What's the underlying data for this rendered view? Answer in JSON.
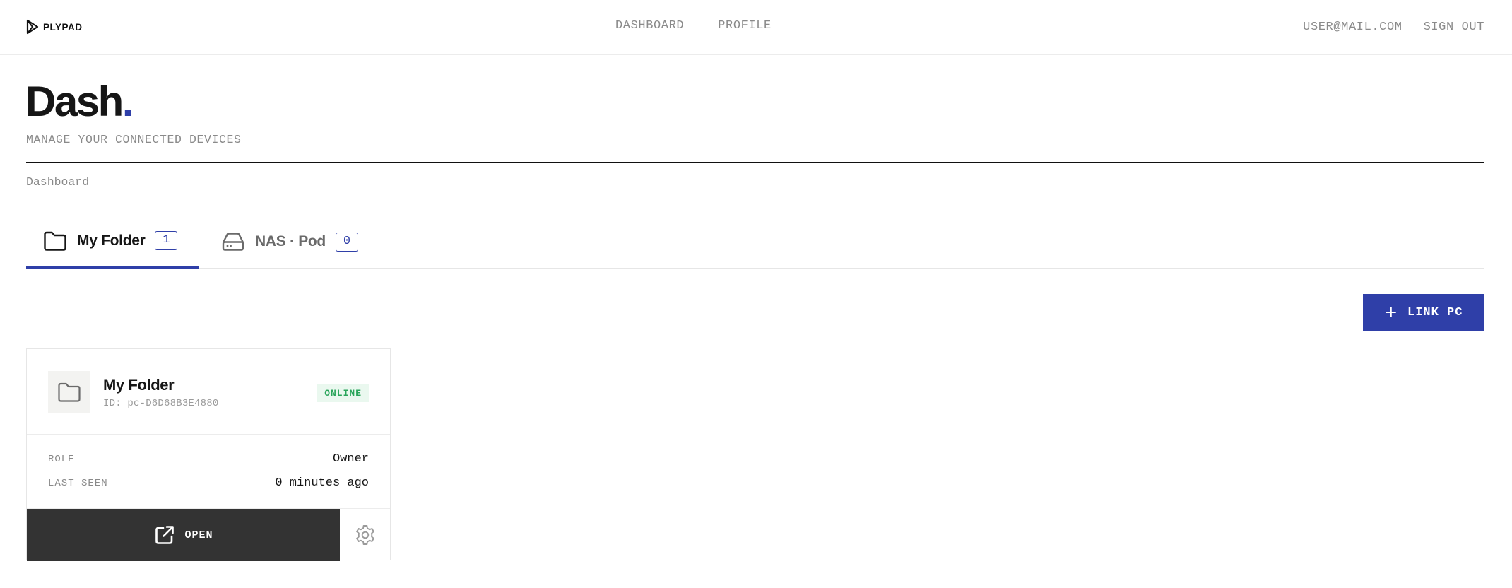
{
  "brand": {
    "name": "PLYPAD",
    "logo_icon": "plypad-logo-icon"
  },
  "nav": {
    "items": [
      {
        "label": "DASHBOARD"
      },
      {
        "label": "PROFILE"
      }
    ]
  },
  "user": {
    "email": "USER@MAIL.COM",
    "signout_label": "SIGN OUT"
  },
  "header": {
    "title": "Dash",
    "title_dot": ".",
    "subtitle": "MANAGE YOUR CONNECTED DEVICES"
  },
  "breadcrumb": "Dashboard",
  "tabs": [
    {
      "label": "My Folder",
      "count": "1",
      "icon": "folder-icon",
      "active": true
    },
    {
      "label": "NAS · Pod",
      "count": "0",
      "icon": "hard-drive-icon",
      "active": false
    }
  ],
  "actions": {
    "link_pc_label": "LINK PC",
    "link_pc_icon": "plus-icon"
  },
  "device": {
    "name": "My Folder",
    "id_text": "ID: pc-D6D68B3E4880",
    "status": "ONLINE",
    "role_label": "ROLE",
    "role_value": "Owner",
    "last_seen_label": "LAST SEEN",
    "last_seen_value": "0 minutes ago",
    "open_label": "OPEN",
    "open_icon": "external-link-icon",
    "settings_icon": "gear-icon"
  },
  "colors": {
    "accent": "#2f3fa8",
    "dark": "#333333",
    "online_text": "#2aa55b",
    "online_bg": "#eaf8ef",
    "muted": "#8a8a8a"
  }
}
